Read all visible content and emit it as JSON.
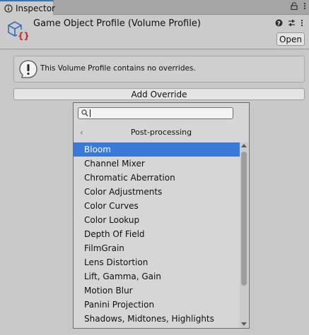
{
  "tab": {
    "label": "Inspector",
    "icon": "info-icon"
  },
  "tab_icons": [
    "lock-icon",
    "kebab-menu-icon"
  ],
  "header": {
    "title": "Game Object Profile (Volume Profile)",
    "icon": "volume-profile-icon",
    "icons": [
      "help-icon",
      "presets-icon",
      "kebab-menu-icon"
    ],
    "open_label": "Open"
  },
  "help": {
    "text": "This Volume Profile contains no overrides.",
    "icon": "warning-icon"
  },
  "add_override_label": "Add Override",
  "dropdown": {
    "search_value": "",
    "section_title": "Post-processing",
    "back_glyph": "‹",
    "items": [
      "Bloom",
      "Channel Mixer",
      "Chromatic Aberration",
      "Color Adjustments",
      "Color Curves",
      "Color Lookup",
      "Depth Of Field",
      "FilmGrain",
      "Lens Distortion",
      "Lift, Gamma, Gain",
      "Motion Blur",
      "Panini Projection",
      "Shadows, Midtones, Highlights"
    ],
    "selected_index": 0
  },
  "colors": {
    "selection": "#3a79d7",
    "tab_accent": "#3a72b0"
  }
}
